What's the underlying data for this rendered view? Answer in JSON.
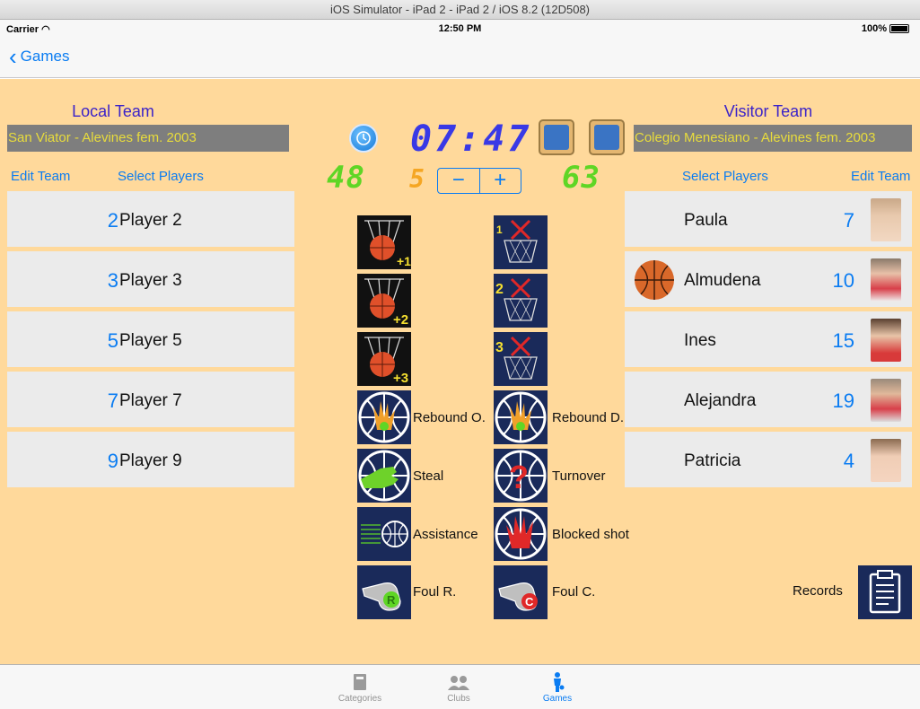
{
  "window_title": "iOS Simulator - iPad 2 - iPad 2 / iOS 8.2 (12D508)",
  "status": {
    "carrier": "Carrier",
    "time": "12:50 PM",
    "battery": "100%"
  },
  "nav": {
    "back_label": "Games"
  },
  "local": {
    "title": "Local Team",
    "name": "San Viator - Alevines fem. 2003",
    "edit": "Edit Team",
    "select": "Select Players",
    "score": "48",
    "players": [
      {
        "num": "2",
        "name": "Player 2"
      },
      {
        "num": "3",
        "name": "Player 3"
      },
      {
        "num": "5",
        "name": "Player 5"
      },
      {
        "num": "7",
        "name": "Player 7"
      },
      {
        "num": "9",
        "name": "Player 9"
      }
    ]
  },
  "visitor": {
    "title": "Visitor Team",
    "name": "Colegio Menesiano - Alevines fem. 2003",
    "edit": "Edit Team",
    "select": "Select Players",
    "score": "63",
    "players": [
      {
        "num": "7",
        "name": "Paula"
      },
      {
        "num": "10",
        "name": "Almudena"
      },
      {
        "num": "15",
        "name": "Ines"
      },
      {
        "num": "19",
        "name": "Alejandra"
      },
      {
        "num": "4",
        "name": "Patricia"
      }
    ]
  },
  "game": {
    "timer": "07:47",
    "period": "5",
    "minus": "−",
    "plus": "+"
  },
  "actions": {
    "rebound_o": "Rebound O.",
    "rebound_d": "Rebound D.",
    "steal": "Steal",
    "turnover": "Turnover",
    "assistance": "Assistance",
    "blocked": "Blocked shot",
    "foul_r": "Foul R.",
    "foul_c": "Foul C.",
    "records": "Records"
  },
  "tabs": [
    {
      "label": "Categories",
      "active": false
    },
    {
      "label": "Clubs",
      "active": false
    },
    {
      "label": "Games",
      "active": true
    }
  ],
  "colors": {
    "background": "#ffd99b",
    "accent": "#0a7cf2",
    "score": "#5fd625",
    "timer": "#3939e6"
  }
}
